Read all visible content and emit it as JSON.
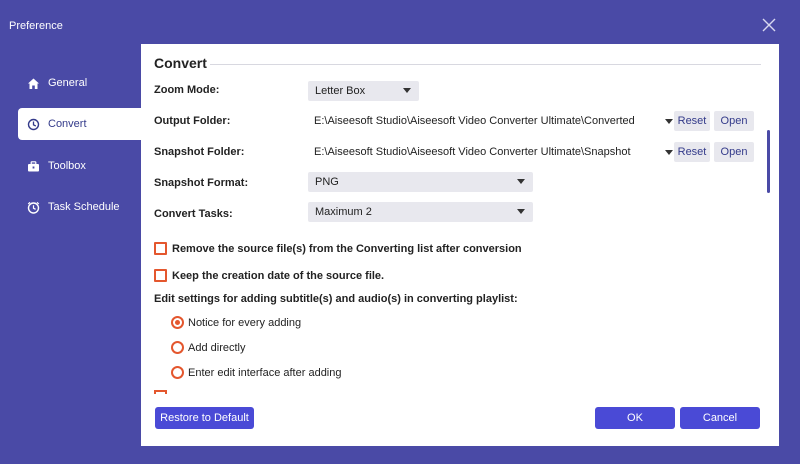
{
  "window": {
    "title": "Preference"
  },
  "sidebar": {
    "items": [
      {
        "label": "General",
        "icon": "home-icon",
        "active": false
      },
      {
        "label": "Convert",
        "icon": "convert-icon",
        "active": true
      },
      {
        "label": "Toolbox",
        "icon": "toolbox-icon",
        "active": false
      },
      {
        "label": "Task Schedule",
        "icon": "clock-icon",
        "active": false
      }
    ]
  },
  "convert": {
    "section_title": "Convert",
    "zoom_mode": {
      "label": "Zoom Mode:",
      "value": "Letter Box"
    },
    "output_folder": {
      "label": "Output Folder:",
      "path": "E:\\Aiseesoft Studio\\Aiseesoft Video Converter Ultimate\\Converted",
      "reset": "Reset",
      "open": "Open"
    },
    "snapshot_folder": {
      "label": "Snapshot Folder:",
      "path": "E:\\Aiseesoft Studio\\Aiseesoft Video Converter Ultimate\\Snapshot",
      "reset": "Reset",
      "open": "Open"
    },
    "snapshot_format": {
      "label": "Snapshot Format:",
      "value": "PNG"
    },
    "convert_tasks": {
      "label": "Convert Tasks:",
      "value": "Maximum 2"
    },
    "remove_source": {
      "label": "Remove the source file(s) from the Converting list after conversion",
      "checked": false
    },
    "keep_date": {
      "label": "Keep the creation date of the source file.",
      "checked": false
    },
    "subtitle_hint": "Edit settings for adding subtitle(s) and audio(s) in converting playlist:",
    "radio_options": [
      {
        "label": "Notice for every adding",
        "selected": true
      },
      {
        "label": "Add directly",
        "selected": false
      },
      {
        "label": "Enter edit interface after adding",
        "selected": false
      }
    ]
  },
  "footer": {
    "restore": "Restore to Default",
    "ok": "OK",
    "cancel": "Cancel"
  },
  "colors": {
    "frame": "#4a4aa6",
    "accent": "#e4572e",
    "primary_button": "#4a4ad6"
  }
}
